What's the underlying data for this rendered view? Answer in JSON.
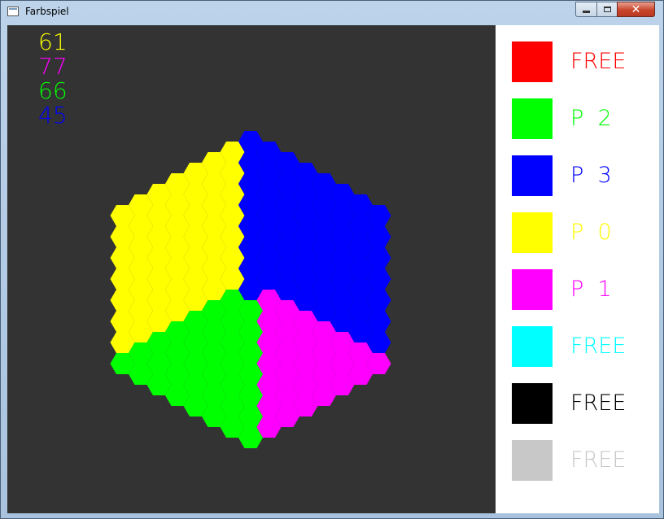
{
  "window": {
    "title": "Farbspiel"
  },
  "title_buttons": {
    "minimize": "–",
    "maximize": "□",
    "close": "✕"
  },
  "scores": [
    {
      "value": "61",
      "color": "#ffff00"
    },
    {
      "value": "77",
      "color": "#ff00ff"
    },
    {
      "value": "66",
      "color": "#00ff00"
    },
    {
      "value": "45",
      "color": "#0000ff"
    }
  ],
  "palette": [
    {
      "label": "FREE",
      "color": "#ff0000"
    },
    {
      "label": "P  2",
      "color": "#00ff00"
    },
    {
      "label": "P  3",
      "color": "#0000ff"
    },
    {
      "label": "P  0",
      "color": "#ffff00"
    },
    {
      "label": "P  1",
      "color": "#ff00ff"
    },
    {
      "label": "FREE",
      "color": "#00ffff"
    },
    {
      "label": "FREE",
      "color": "#000000"
    },
    {
      "label": "FREE",
      "color": "#c8c8c8"
    }
  ],
  "board": {
    "background": "#333333",
    "colors": {
      "Y": "#ffff00",
      "M": "#ff00ff",
      "G": "#00ff00",
      "B": "#0000ff",
      "C": "#00ffff",
      "R": "#ff0000",
      "K": "#000000"
    },
    "territories": [
      "Y",
      "B",
      "G",
      "M"
    ]
  }
}
